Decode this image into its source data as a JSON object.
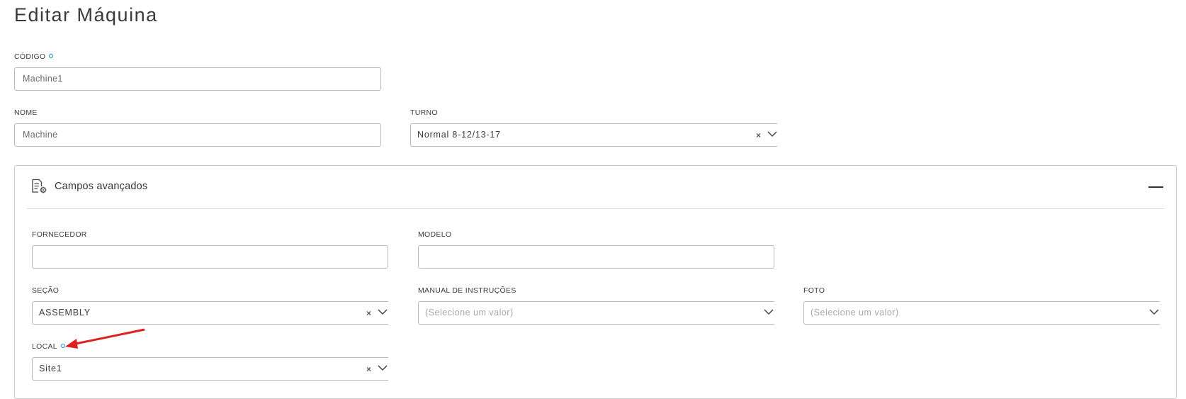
{
  "page": {
    "title": "Editar Máquina"
  },
  "fields": {
    "codigo": {
      "label": "CÓDIGO",
      "value": "Machine1",
      "required": true
    },
    "nome": {
      "label": "NOME",
      "value": "Machine"
    },
    "turno": {
      "label": "TURNO",
      "value": "Normal 8-12/13-17"
    }
  },
  "advanced": {
    "title": "Campos avançados",
    "collapse_icon": "minus-icon",
    "fornecedor": {
      "label": "FORNECEDOR",
      "value": ""
    },
    "modelo": {
      "label": "MODELO",
      "value": ""
    },
    "secao": {
      "label": "SEÇÃO",
      "value": "ASSEMBLY"
    },
    "manual": {
      "label": "MANUAL DE INSTRUÇÕES",
      "placeholder": "(Selecione um valor)"
    },
    "foto": {
      "label": "FOTO",
      "placeholder": "(Selecione um valor)"
    },
    "local": {
      "label": "LOCAL",
      "value": "Site1",
      "required": true
    }
  },
  "icons": {
    "clear": "×",
    "required_color": "#1a8fc9",
    "annotation_arrow_color": "#e02020"
  }
}
